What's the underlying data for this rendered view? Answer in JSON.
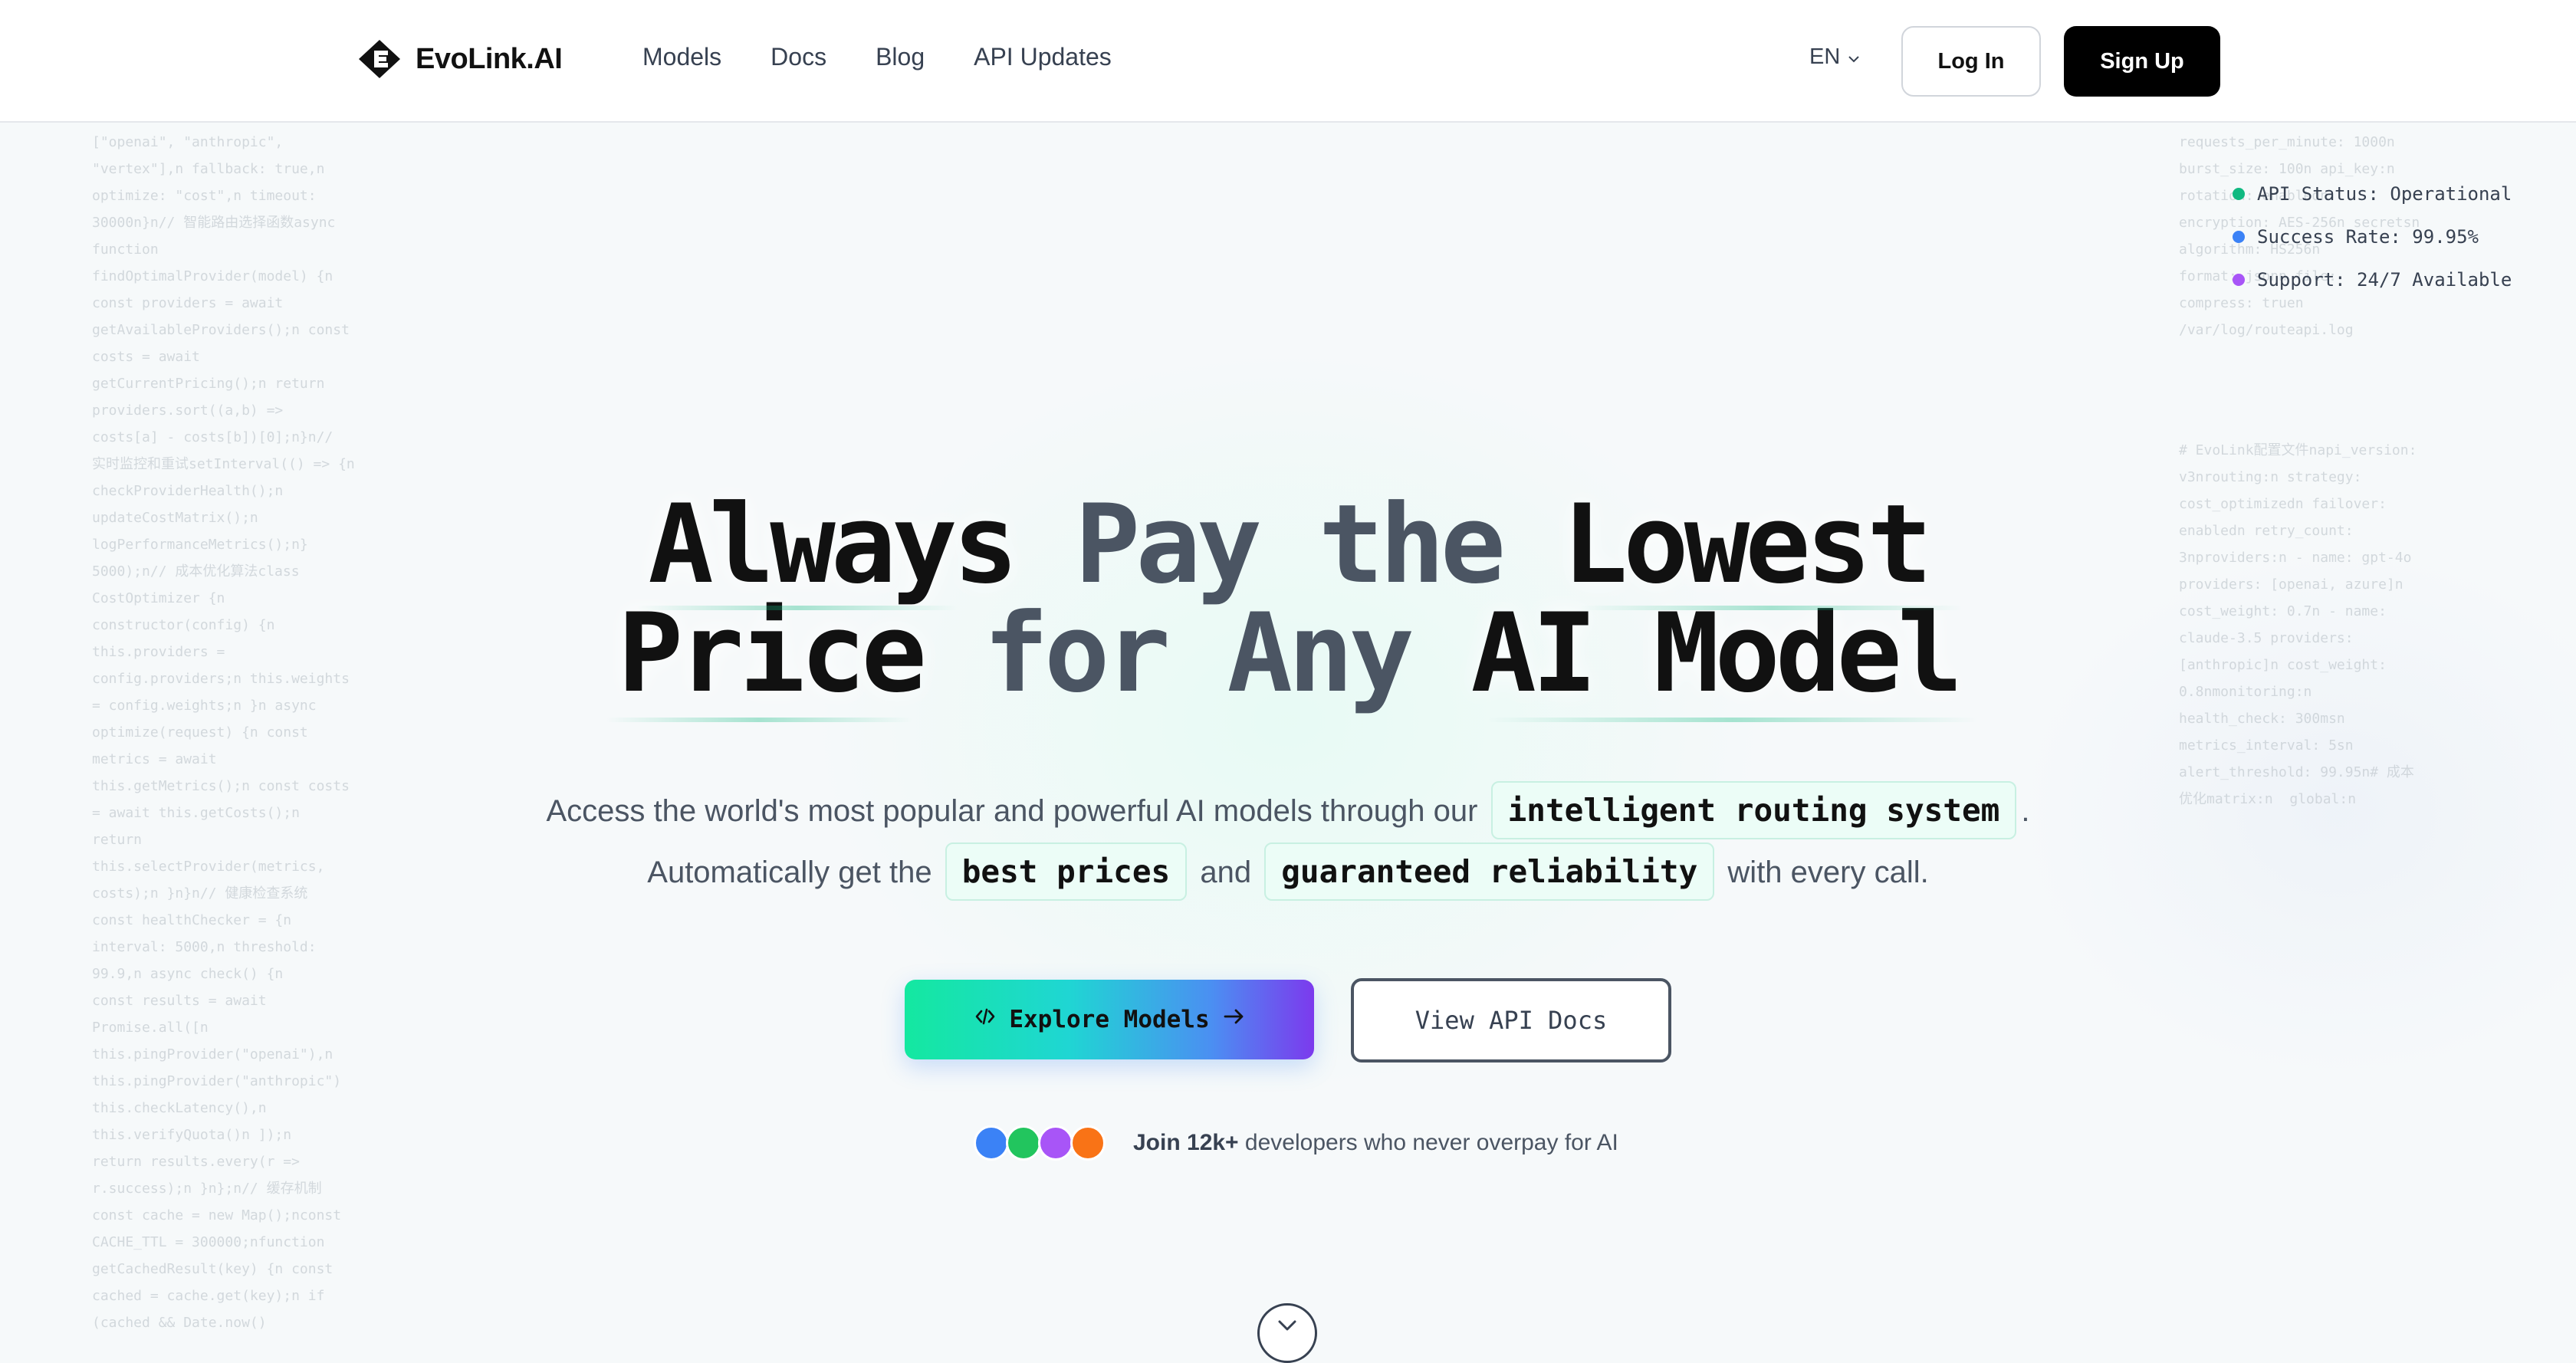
{
  "header": {
    "logo_text": "EvoLink.AI",
    "nav": [
      "Models",
      "Docs",
      "Blog",
      "API Updates"
    ],
    "language": "EN",
    "login_label": "Log In",
    "signup_label": "Sign Up"
  },
  "status": [
    {
      "label": "API Status: Operational",
      "color": "#10b981"
    },
    {
      "label": "Success Rate: 99.95%",
      "color": "#3b82f6"
    },
    {
      "label": "Support: 24/7 Available",
      "color": "#a855f7"
    }
  ],
  "hero": {
    "title_line1": {
      "w1": "Always",
      "w2": "Pay",
      "w3": "the",
      "w4": "Lowest"
    },
    "title_line2": {
      "w1": "Price",
      "w2": "for",
      "w3": "Any",
      "w4": "AI Model"
    },
    "sub1_pre": "Access the world's most popular and powerful AI models through our",
    "sub1_chip": "intelligent routing system",
    "sub1_post": ".",
    "sub2_pre": "Automatically get the",
    "sub2_chip1": "best prices",
    "sub2_mid": "and",
    "sub2_chip2": "guaranteed reliability",
    "sub2_post": "with every call.",
    "explore_label": "Explore Models",
    "docs_label": "View API Docs",
    "social_bold": "Join 12k+",
    "social_rest": "developers who never overpay for AI",
    "avatar_colors": [
      "#3b82f6",
      "#22c55e",
      "#a855f7",
      "#f97316"
    ]
  },
  "code_left": "[\"openai\", \"anthropic\",\n\"vertex\"],n fallback: true,n\noptimize: \"cost\",n timeout:\n30000n}n// 智能路由选择函数async\nfunction\nfindOptimalProvider(model) {n\nconst providers = await\ngetAvailableProviders();n const\ncosts = await\ngetCurrentPricing();n return\nproviders.sort((a,b) =>\ncosts[a] - costs[b])[0];n}n//\n实时监控和重试setInterval(() => {n\ncheckProviderHealth();n\nupdateCostMatrix();n\nlogPerformanceMetrics();n}\n5000);n// 成本优化算法class\nCostOptimizer {n\nconstructor(config) {n\nthis.providers =\nconfig.providers;n this.weights\n= config.weights;n }n async\noptimize(request) {n const\nmetrics = await\nthis.getMetrics();n const costs\n= await this.getCosts();n\nreturn\nthis.selectProvider(metrics,\ncosts);n }n}n// 健康检查系统\nconst healthChecker = {n\ninterval: 5000,n threshold:\n99.9,n async check() {n\nconst results = await\nPromise.all([n\nthis.pingProvider(\"openai\"),n\nthis.pingProvider(\"anthropic\")\nthis.checkLatency(),n\nthis.verifyQuota()n ]);n\nreturn results.every(r =>\nr.success);n }n};n// 缓存机制\nconst cache = new Map();nconst\nCACHE_TTL = 300000;nfunction\ngetCachedResult(key) {n const\ncached = cache.get(key);n if\n(cached && Date.now()",
  "code_right_1": "requests_per_minute: 1000n\nburst_size: 100n api_key:n\nrotation: enabledn\nencryption: AES-256n secretsn\nalgorithm: HS256n\nformat: jsonn file:\ncompress: truen\n/var/log/routeapi.log",
  "code_right_2": "# EvoLink配置文件napi_version:\nv3nrouting:n strategy:\ncost_optimizedn failover:\nenabledn retry_count:\n3nproviders:n - name: gpt-4o\nproviders: [openai, azure]n\ncost_weight: 0.7n - name:\nclaude-3.5 providers:\n[anthropic]n cost_weight:\n0.8nmonitoring:n\nhealth_check: 300msn\nmetrics_interval: 5sn\nalert_threshold: 99.95n# 成本\n优化matrix:n  global:n"
}
